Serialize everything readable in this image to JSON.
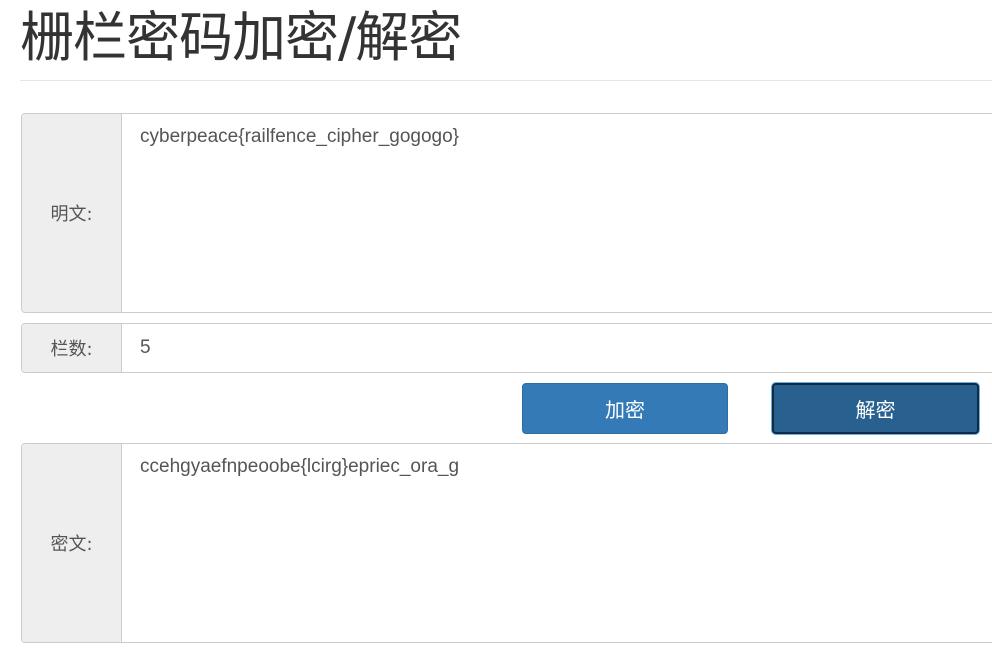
{
  "page": {
    "title": "栅栏密码加密/解密"
  },
  "form": {
    "plaintext": {
      "label": "明文:",
      "value": "cyberpeace{railfence_cipher_gogogo}"
    },
    "rails": {
      "label": "栏数:",
      "value": "5"
    },
    "ciphertext": {
      "label": "密文:",
      "value": "ccehgyaefnpeoobe{lcirg}epriec_ora_g"
    }
  },
  "buttons": {
    "encrypt_label": "加密",
    "decrypt_label": "解密"
  },
  "colors": {
    "primary": "#337ab7",
    "primary_active": "#286090",
    "addon_bg": "#eeeeee",
    "border": "#cccccc"
  }
}
